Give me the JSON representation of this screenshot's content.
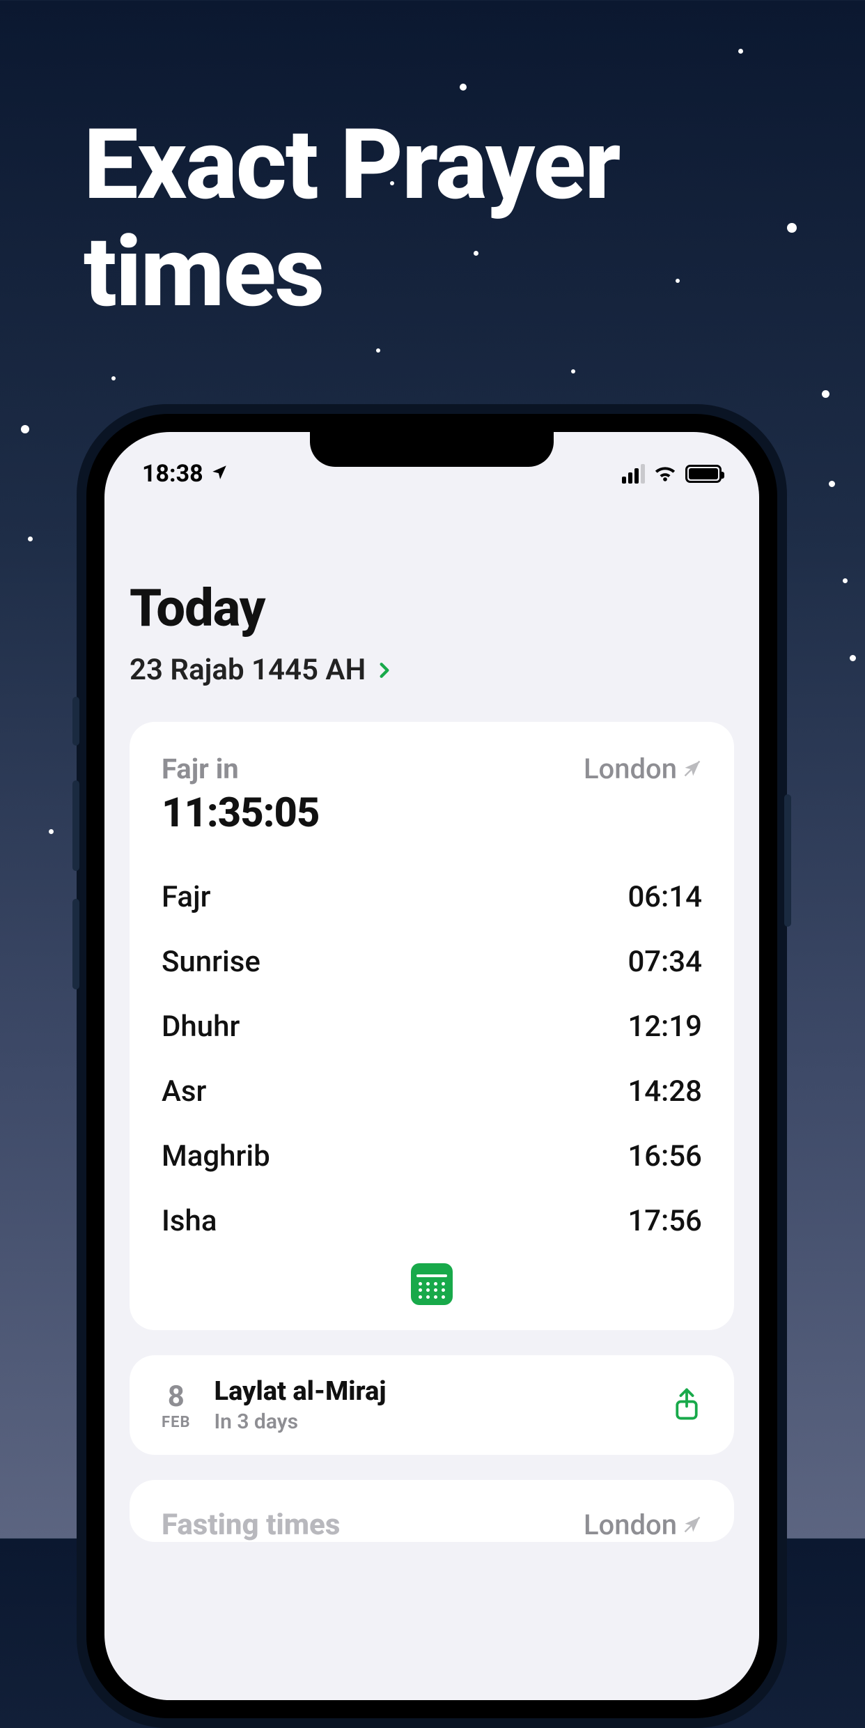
{
  "headline_line1": "Exact Prayer",
  "headline_line2": "times",
  "statusbar": {
    "time": "18:38"
  },
  "page": {
    "title": "Today",
    "hijri_date": "23 Rajab 1445 AH"
  },
  "next_prayer": {
    "label": "Fajr in",
    "countdown": "11:35:05",
    "location": "London"
  },
  "prayers": [
    {
      "name": "Fajr",
      "time": "06:14"
    },
    {
      "name": "Sunrise",
      "time": "07:34"
    },
    {
      "name": "Dhuhr",
      "time": "12:19"
    },
    {
      "name": "Asr",
      "time": "14:28"
    },
    {
      "name": "Maghrib",
      "time": "16:56"
    },
    {
      "name": "Isha",
      "time": "17:56"
    }
  ],
  "event": {
    "day": "8",
    "month": "FEB",
    "name": "Laylat al-Miraj",
    "in": "In 3 days"
  },
  "fasting": {
    "title": "Fasting times",
    "location": "London"
  },
  "colors": {
    "accent": "#18a94a"
  }
}
